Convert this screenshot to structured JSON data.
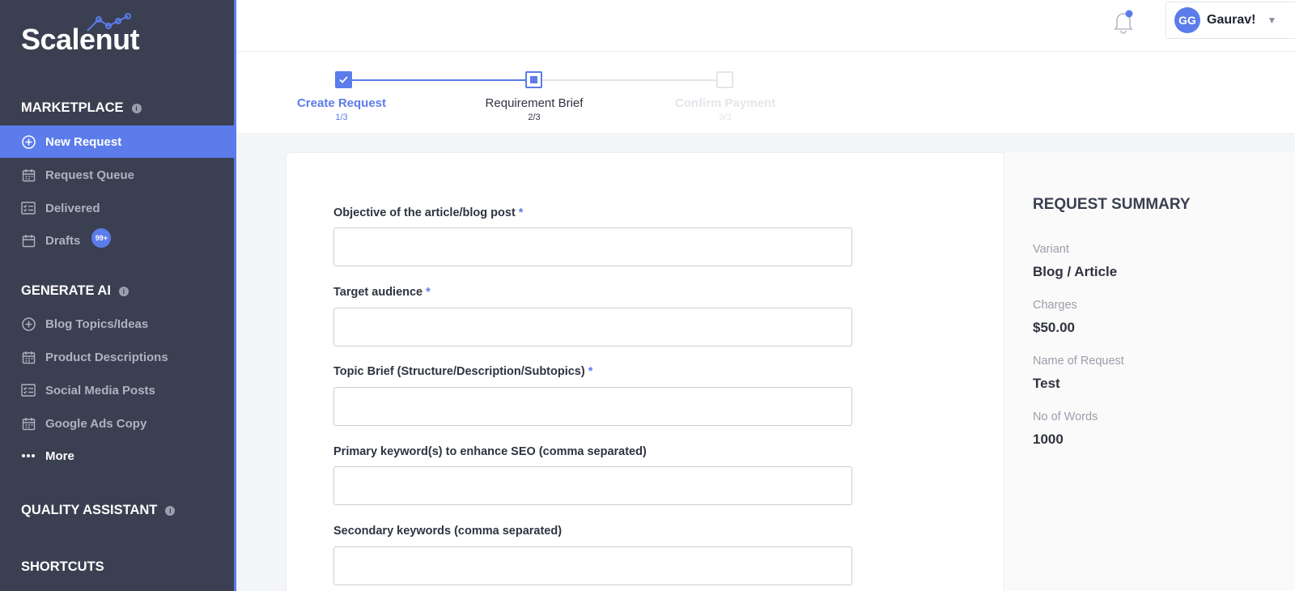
{
  "brand": {
    "name": "Scalenut"
  },
  "sidebar": {
    "marketplace": {
      "title": "MARKETPLACE",
      "items": [
        {
          "label": "New Request",
          "icon": "plus-circle-icon",
          "active": true
        },
        {
          "label": "Request Queue",
          "icon": "calendar-icon"
        },
        {
          "label": "Delivered",
          "icon": "checklist-icon"
        },
        {
          "label": "Drafts",
          "icon": "calendar-icon",
          "badge": "99+"
        }
      ]
    },
    "generate_ai": {
      "title": "GENERATE AI",
      "items": [
        {
          "label": "Blog Topics/Ideas",
          "icon": "plus-circle-icon"
        },
        {
          "label": "Product Descriptions",
          "icon": "calendar-icon"
        },
        {
          "label": "Social Media Posts",
          "icon": "checklist-icon"
        },
        {
          "label": "Google Ads Copy",
          "icon": "calendar-icon"
        },
        {
          "label": "More",
          "icon": "more-dots-icon"
        }
      ]
    },
    "quality_assistant": {
      "title": "QUALITY ASSISTANT"
    },
    "shortcuts": {
      "title": "SHORTCUTS"
    }
  },
  "header": {
    "user": {
      "initials": "GG",
      "name": "Gaurav!"
    }
  },
  "stepper": {
    "steps": [
      {
        "label": "Create Request",
        "sub": "1/3",
        "state": "done"
      },
      {
        "label": "Requirement Brief",
        "sub": "2/3",
        "state": "current"
      },
      {
        "label": "Confirm Payment",
        "sub": "3/3",
        "state": "pending"
      }
    ]
  },
  "form": {
    "fields": [
      {
        "label": "Objective of the article/blog post",
        "required": "*",
        "value": ""
      },
      {
        "label": "Target audience",
        "required": "*",
        "value": ""
      },
      {
        "label": "Topic Brief (Structure/Description/Subtopics)",
        "required": "*",
        "value": ""
      },
      {
        "label": "Primary keyword(s) to enhance SEO (comma separated)",
        "required": "",
        "value": ""
      },
      {
        "label": "Secondary keywords (comma separated)",
        "required": "",
        "value": ""
      }
    ]
  },
  "summary": {
    "title": "REQUEST SUMMARY",
    "rows": [
      {
        "key": "Variant",
        "value": "Blog / Article"
      },
      {
        "key": "Charges",
        "value": "$50.00"
      },
      {
        "key": "Name of Request",
        "value": "Test"
      },
      {
        "key": "No of Words",
        "value": "1000"
      }
    ]
  },
  "colors": {
    "accent": "#5b7cea",
    "sidebar_bg": "#3a3f51",
    "page_bg": "#f4f5f9"
  }
}
